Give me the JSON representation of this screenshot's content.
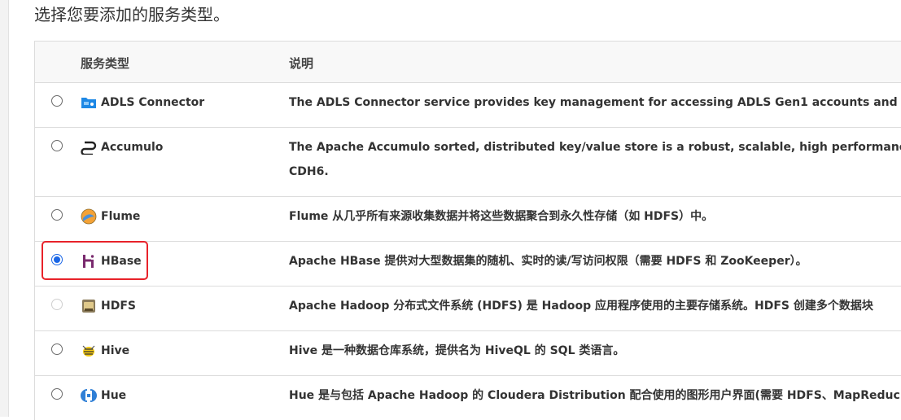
{
  "prompt": "选择您要添加的服务类型。",
  "table": {
    "headers": {
      "service_type": "服务类型",
      "description": "说明"
    },
    "rows": [
      {
        "name": "ADLS Connector",
        "icon": "adls-folder-icon",
        "selected": false,
        "disabled": false,
        "description": "The ADLS Connector service provides key management for accessing ADLS Gen1 accounts and ADLS G"
      },
      {
        "name": "Accumulo",
        "icon": "accumulo-icon",
        "selected": false,
        "disabled": false,
        "description": "The Apache Accumulo sorted, distributed key/value store is a robust, scalable, high performance data s",
        "description_line2": "CDH6."
      },
      {
        "name": "Flume",
        "icon": "flume-icon",
        "selected": false,
        "disabled": false,
        "description": "Flume 从几乎所有来源收集数据并将这些数据聚合到永久性存储（如 HDFS）中。"
      },
      {
        "name": "HBase",
        "icon": "hbase-icon",
        "selected": true,
        "disabled": false,
        "description": "Apache HBase 提供对大型数据集的随机、实时的读/写访问权限（需要 HDFS 和 ZooKeeper）。"
      },
      {
        "name": "HDFS",
        "icon": "hdfs-elephant-icon",
        "selected": false,
        "disabled": true,
        "description": "Apache Hadoop 分布式文件系统 (HDFS) 是 Hadoop 应用程序使用的主要存储系统。HDFS 创建多个数据块"
      },
      {
        "name": "Hive",
        "icon": "hive-bee-icon",
        "selected": false,
        "disabled": false,
        "description": "Hive 是一种数据仓库系统，提供名为 HiveQL 的 SQL 类语言。"
      },
      {
        "name": "Hue",
        "icon": "hue-icon",
        "selected": false,
        "disabled": false,
        "description": "Hue 是与包括 Apache Hadoop 的 Cloudera Distribution 配合使用的图形用户界面(需要 HDFS、MapReduc"
      }
    ]
  },
  "colors": {
    "highlight": "#e8222a",
    "radio_checked": "#1a66e6"
  }
}
